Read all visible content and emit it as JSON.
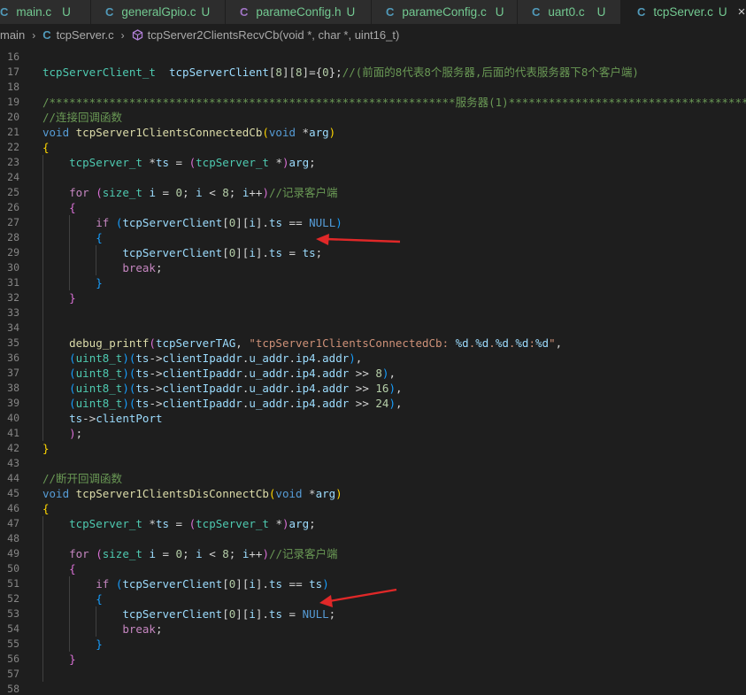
{
  "tabs": [
    {
      "label": "main.c",
      "status": "U",
      "icon": "c-file-icon"
    },
    {
      "label": "generalGpio.c",
      "status": "U",
      "icon": "c-file-icon"
    },
    {
      "label": "parameConfig.h",
      "status": "U",
      "icon": "h-file-icon"
    },
    {
      "label": "parameConfig.c",
      "status": "U",
      "icon": "c-file-icon"
    },
    {
      "label": "uart0.c",
      "status": "U",
      "icon": "c-file-icon"
    },
    {
      "label": "tcpServer.c",
      "status": "U",
      "icon": "c-file-icon",
      "active": true
    }
  ],
  "tab_icon_glyph": "C",
  "tab_close_glyph": "×",
  "breadcrumb": {
    "items": [
      "main",
      "tcpServer.c",
      "tcpServer2ClientsRecvCb(void *, char *, uint16_t)"
    ],
    "separator": "›"
  },
  "colors": {
    "background": "#1e1e1e",
    "keyword": "#569cd6",
    "control": "#c586c0",
    "type": "#4ec9b0",
    "function": "#dcdcaa",
    "variable": "#9cdcfe",
    "number": "#b5cea8",
    "string": "#ce9178",
    "comment": "#6a9955",
    "git_untracked": "#73c991",
    "annotation_arrow": "#e02828"
  },
  "editor": {
    "lines": [
      {
        "n": "16",
        "t": []
      },
      {
        "n": "17",
        "t": [
          [
            "ty",
            "tcpServerClient_t"
          ],
          [
            "",
            "  "
          ],
          [
            "var",
            "tcpServerClient"
          ],
          [
            "",
            "["
          ],
          [
            "num",
            "8"
          ],
          [
            "",
            "]["
          ],
          [
            "num",
            "8"
          ],
          [
            "",
            "]={"
          ],
          [
            "num",
            "0"
          ],
          [
            "",
            "};"
          ],
          [
            "cm",
            "//(前面的8代表8个服务器,后面的代表服务器下8个客户端)"
          ]
        ]
      },
      {
        "n": "18",
        "t": []
      },
      {
        "n": "19",
        "t": [
          [
            "cm",
            "/*************************************************************服务器(1)******************************************"
          ]
        ]
      },
      {
        "n": "20",
        "t": [
          [
            "cm",
            "//连接回调函数"
          ]
        ]
      },
      {
        "n": "21",
        "t": [
          [
            "kw",
            "void"
          ],
          [
            "",
            " "
          ],
          [
            "fn",
            "tcpServer1ClientsConnectedCb"
          ],
          [
            "b1",
            "("
          ],
          [
            "kw",
            "void"
          ],
          [
            "",
            " *"
          ],
          [
            "var",
            "arg"
          ],
          [
            "b1",
            ")"
          ]
        ]
      },
      {
        "n": "22",
        "t": [
          [
            "b1",
            "{"
          ]
        ]
      },
      {
        "n": "23",
        "t": [
          [
            "",
            "    "
          ],
          [
            "ty",
            "tcpServer_t"
          ],
          [
            "",
            " *"
          ],
          [
            "var",
            "ts"
          ],
          [
            "",
            " = "
          ],
          [
            "b2",
            "("
          ],
          [
            "ty",
            "tcpServer_t"
          ],
          [
            "",
            " *"
          ],
          [
            "b2",
            ")"
          ],
          [
            "var",
            "arg"
          ],
          [
            "",
            ";"
          ]
        ]
      },
      {
        "n": "24",
        "t": []
      },
      {
        "n": "25",
        "t": [
          [
            "",
            "    "
          ],
          [
            "ctl",
            "for"
          ],
          [
            "",
            " "
          ],
          [
            "b2",
            "("
          ],
          [
            "ty",
            "size_t"
          ],
          [
            "",
            " "
          ],
          [
            "var",
            "i"
          ],
          [
            "",
            " = "
          ],
          [
            "num",
            "0"
          ],
          [
            "",
            "; "
          ],
          [
            "var",
            "i"
          ],
          [
            "",
            " < "
          ],
          [
            "num",
            "8"
          ],
          [
            "",
            "; "
          ],
          [
            "var",
            "i"
          ],
          [
            "",
            "++"
          ],
          [
            "b2",
            ")"
          ],
          [
            "cm",
            "//记录客户端"
          ]
        ]
      },
      {
        "n": "26",
        "t": [
          [
            "",
            "    "
          ],
          [
            "b2",
            "{"
          ]
        ]
      },
      {
        "n": "27",
        "t": [
          [
            "",
            "        "
          ],
          [
            "ctl",
            "if"
          ],
          [
            "",
            " "
          ],
          [
            "b3",
            "("
          ],
          [
            "var",
            "tcpServerClient"
          ],
          [
            "",
            "["
          ],
          [
            "num",
            "0"
          ],
          [
            "",
            "]["
          ],
          [
            "var",
            "i"
          ],
          [
            "",
            "]."
          ],
          [
            "var",
            "ts"
          ],
          [
            "",
            " == "
          ],
          [
            "mac",
            "NULL"
          ],
          [
            "b3",
            ")"
          ]
        ]
      },
      {
        "n": "28",
        "t": [
          [
            "",
            "        "
          ],
          [
            "b3",
            "{"
          ]
        ]
      },
      {
        "n": "29",
        "t": [
          [
            "",
            "            "
          ],
          [
            "var",
            "tcpServerClient"
          ],
          [
            "",
            "["
          ],
          [
            "num",
            "0"
          ],
          [
            "",
            "]["
          ],
          [
            "var",
            "i"
          ],
          [
            "",
            "]."
          ],
          [
            "var",
            "ts"
          ],
          [
            "",
            " = "
          ],
          [
            "var",
            "ts"
          ],
          [
            "",
            ";"
          ]
        ]
      },
      {
        "n": "30",
        "t": [
          [
            "",
            "            "
          ],
          [
            "ctl",
            "break"
          ],
          [
            "",
            ";"
          ]
        ]
      },
      {
        "n": "31",
        "t": [
          [
            "",
            "        "
          ],
          [
            "b3",
            "}"
          ]
        ]
      },
      {
        "n": "32",
        "t": [
          [
            "",
            "    "
          ],
          [
            "b2",
            "}"
          ]
        ]
      },
      {
        "n": "33",
        "t": []
      },
      {
        "n": "34",
        "t": []
      },
      {
        "n": "35",
        "t": [
          [
            "",
            "    "
          ],
          [
            "fn",
            "debug_printf"
          ],
          [
            "b2",
            "("
          ],
          [
            "var",
            "tcpServerTAG"
          ],
          [
            "",
            ", "
          ],
          [
            "str",
            "\"tcpServer1ClientsConnectedCb: "
          ],
          [
            "fmt",
            "%d"
          ],
          [
            "str",
            "."
          ],
          [
            "fmt",
            "%d"
          ],
          [
            "str",
            "."
          ],
          [
            "fmt",
            "%d"
          ],
          [
            "str",
            "."
          ],
          [
            "fmt",
            "%d"
          ],
          [
            "str",
            ":"
          ],
          [
            "fmt",
            "%d"
          ],
          [
            "str",
            "\""
          ],
          [
            "",
            ","
          ]
        ]
      },
      {
        "n": "36",
        "t": [
          [
            "",
            "    "
          ],
          [
            "b3",
            "("
          ],
          [
            "ty",
            "uint8_t"
          ],
          [
            "b3",
            ")"
          ],
          [
            "b3",
            "("
          ],
          [
            "var",
            "ts"
          ],
          [
            "",
            "->"
          ],
          [
            "var",
            "clientIpaddr"
          ],
          [
            "",
            "."
          ],
          [
            "var",
            "u_addr"
          ],
          [
            "",
            "."
          ],
          [
            "var",
            "ip4"
          ],
          [
            "",
            "."
          ],
          [
            "var",
            "addr"
          ],
          [
            "b3",
            ")"
          ],
          [
            "",
            ","
          ]
        ]
      },
      {
        "n": "37",
        "t": [
          [
            "",
            "    "
          ],
          [
            "b3",
            "("
          ],
          [
            "ty",
            "uint8_t"
          ],
          [
            "b3",
            ")"
          ],
          [
            "b3",
            "("
          ],
          [
            "var",
            "ts"
          ],
          [
            "",
            "->"
          ],
          [
            "var",
            "clientIpaddr"
          ],
          [
            "",
            "."
          ],
          [
            "var",
            "u_addr"
          ],
          [
            "",
            "."
          ],
          [
            "var",
            "ip4"
          ],
          [
            "",
            "."
          ],
          [
            "var",
            "addr"
          ],
          [
            "",
            " >> "
          ],
          [
            "num",
            "8"
          ],
          [
            "b3",
            ")"
          ],
          [
            "",
            ","
          ]
        ]
      },
      {
        "n": "38",
        "t": [
          [
            "",
            "    "
          ],
          [
            "b3",
            "("
          ],
          [
            "ty",
            "uint8_t"
          ],
          [
            "b3",
            ")"
          ],
          [
            "b3",
            "("
          ],
          [
            "var",
            "ts"
          ],
          [
            "",
            "->"
          ],
          [
            "var",
            "clientIpaddr"
          ],
          [
            "",
            "."
          ],
          [
            "var",
            "u_addr"
          ],
          [
            "",
            "."
          ],
          [
            "var",
            "ip4"
          ],
          [
            "",
            "."
          ],
          [
            "var",
            "addr"
          ],
          [
            "",
            " >> "
          ],
          [
            "num",
            "16"
          ],
          [
            "b3",
            ")"
          ],
          [
            "",
            ","
          ]
        ]
      },
      {
        "n": "39",
        "t": [
          [
            "",
            "    "
          ],
          [
            "b3",
            "("
          ],
          [
            "ty",
            "uint8_t"
          ],
          [
            "b3",
            ")"
          ],
          [
            "b3",
            "("
          ],
          [
            "var",
            "ts"
          ],
          [
            "",
            "->"
          ],
          [
            "var",
            "clientIpaddr"
          ],
          [
            "",
            "."
          ],
          [
            "var",
            "u_addr"
          ],
          [
            "",
            "."
          ],
          [
            "var",
            "ip4"
          ],
          [
            "",
            "."
          ],
          [
            "var",
            "addr"
          ],
          [
            "",
            " >> "
          ],
          [
            "num",
            "24"
          ],
          [
            "b3",
            ")"
          ],
          [
            "",
            ","
          ]
        ]
      },
      {
        "n": "40",
        "t": [
          [
            "",
            "    "
          ],
          [
            "var",
            "ts"
          ],
          [
            "",
            "->"
          ],
          [
            "var",
            "clientPort"
          ]
        ]
      },
      {
        "n": "41",
        "t": [
          [
            "",
            "    "
          ],
          [
            "b2",
            ")"
          ],
          [
            "",
            ";"
          ]
        ]
      },
      {
        "n": "42",
        "t": [
          [
            "b1",
            "}"
          ]
        ]
      },
      {
        "n": "43",
        "t": []
      },
      {
        "n": "44",
        "t": [
          [
            "cm",
            "//断开回调函数"
          ]
        ]
      },
      {
        "n": "45",
        "t": [
          [
            "kw",
            "void"
          ],
          [
            "",
            " "
          ],
          [
            "fn",
            "tcpServer1ClientsDisConnectCb"
          ],
          [
            "b1",
            "("
          ],
          [
            "kw",
            "void"
          ],
          [
            "",
            " *"
          ],
          [
            "var",
            "arg"
          ],
          [
            "b1",
            ")"
          ]
        ]
      },
      {
        "n": "46",
        "t": [
          [
            "b1",
            "{"
          ]
        ]
      },
      {
        "n": "47",
        "t": [
          [
            "",
            "    "
          ],
          [
            "ty",
            "tcpServer_t"
          ],
          [
            "",
            " *"
          ],
          [
            "var",
            "ts"
          ],
          [
            "",
            " = "
          ],
          [
            "b2",
            "("
          ],
          [
            "ty",
            "tcpServer_t"
          ],
          [
            "",
            " *"
          ],
          [
            "b2",
            ")"
          ],
          [
            "var",
            "arg"
          ],
          [
            "",
            ";"
          ]
        ]
      },
      {
        "n": "48",
        "t": []
      },
      {
        "n": "49",
        "t": [
          [
            "",
            "    "
          ],
          [
            "ctl",
            "for"
          ],
          [
            "",
            " "
          ],
          [
            "b2",
            "("
          ],
          [
            "ty",
            "size_t"
          ],
          [
            "",
            " "
          ],
          [
            "var",
            "i"
          ],
          [
            "",
            " = "
          ],
          [
            "num",
            "0"
          ],
          [
            "",
            "; "
          ],
          [
            "var",
            "i"
          ],
          [
            "",
            " < "
          ],
          [
            "num",
            "8"
          ],
          [
            "",
            "; "
          ],
          [
            "var",
            "i"
          ],
          [
            "",
            "++"
          ],
          [
            "b2",
            ")"
          ],
          [
            "cm",
            "//记录客户端"
          ]
        ]
      },
      {
        "n": "50",
        "t": [
          [
            "",
            "    "
          ],
          [
            "b2",
            "{"
          ]
        ]
      },
      {
        "n": "51",
        "t": [
          [
            "",
            "        "
          ],
          [
            "ctl",
            "if"
          ],
          [
            "",
            " "
          ],
          [
            "b3",
            "("
          ],
          [
            "var",
            "tcpServerClient"
          ],
          [
            "",
            "["
          ],
          [
            "num",
            "0"
          ],
          [
            "",
            "]["
          ],
          [
            "var",
            "i"
          ],
          [
            "",
            "]."
          ],
          [
            "var",
            "ts"
          ],
          [
            "",
            " == "
          ],
          [
            "var",
            "ts"
          ],
          [
            "b3",
            ")"
          ]
        ]
      },
      {
        "n": "52",
        "t": [
          [
            "",
            "        "
          ],
          [
            "b3",
            "{"
          ]
        ]
      },
      {
        "n": "53",
        "t": [
          [
            "",
            "            "
          ],
          [
            "var",
            "tcpServerClient"
          ],
          [
            "",
            "["
          ],
          [
            "num",
            "0"
          ],
          [
            "",
            "]["
          ],
          [
            "var",
            "i"
          ],
          [
            "",
            "]."
          ],
          [
            "var",
            "ts"
          ],
          [
            "",
            " = "
          ],
          [
            "mac",
            "NULL"
          ],
          [
            "",
            ";"
          ]
        ]
      },
      {
        "n": "54",
        "t": [
          [
            "",
            "            "
          ],
          [
            "ctl",
            "break"
          ],
          [
            "",
            ";"
          ]
        ]
      },
      {
        "n": "55",
        "t": [
          [
            "",
            "        "
          ],
          [
            "b3",
            "}"
          ]
        ]
      },
      {
        "n": "56",
        "t": [
          [
            "",
            "    "
          ],
          [
            "b2",
            "}"
          ]
        ]
      },
      {
        "n": "57",
        "t": []
      },
      {
        "n": "58",
        "t": []
      }
    ]
  }
}
